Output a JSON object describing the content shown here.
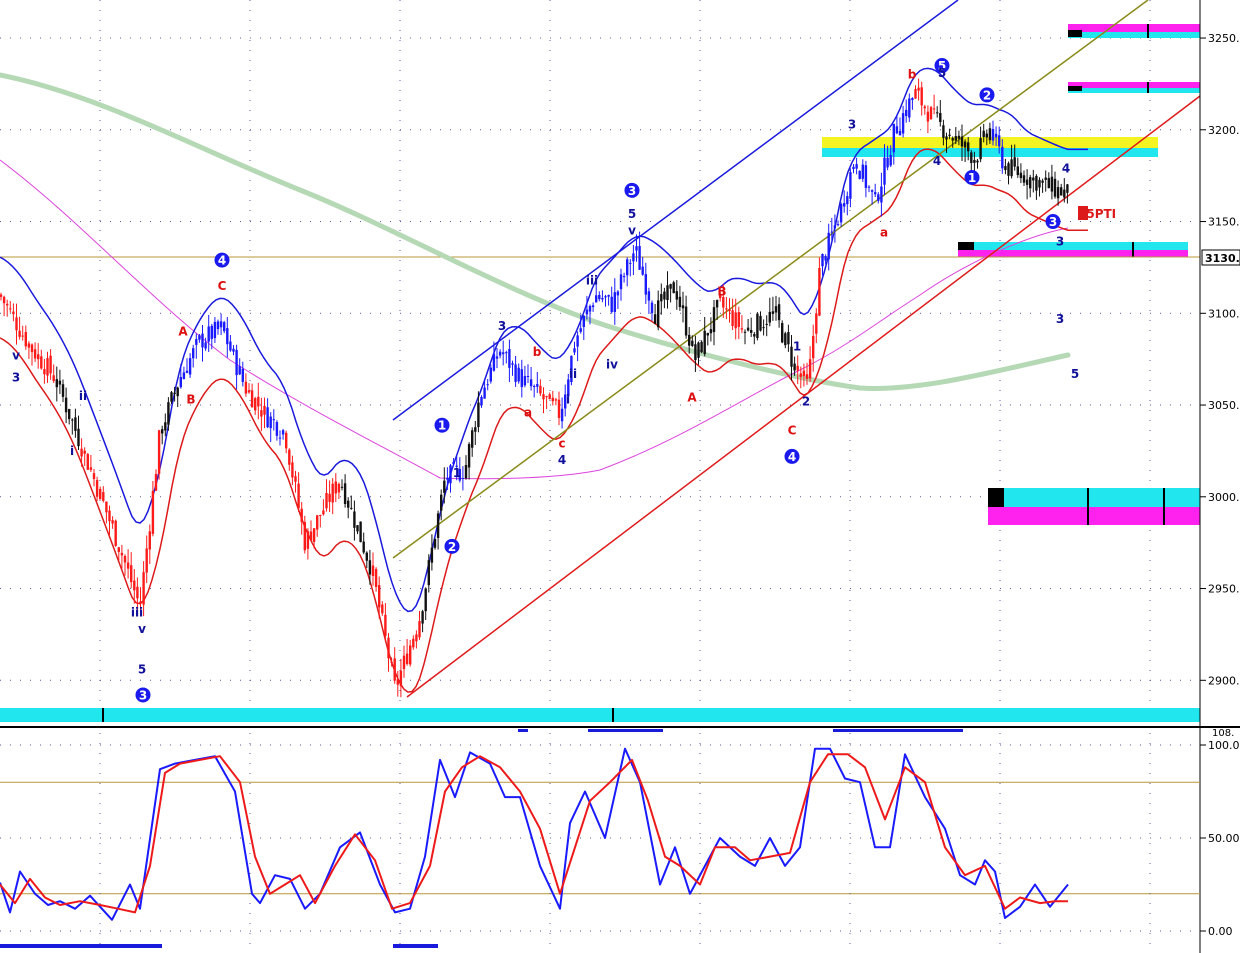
{
  "chart_data": [
    {
      "type": "candlestick",
      "panel": "price",
      "title": "",
      "xlabel": "",
      "ylabel": "",
      "ylim": [
        2880,
        3268
      ],
      "y_ticks": [
        2900,
        2950,
        3000,
        3050,
        3100,
        3150,
        3200,
        3250
      ],
      "y_tick_labels": [
        "2900.",
        "2950.",
        "3000.",
        "3050.",
        "3100.",
        "3150.",
        "3200.",
        "3250."
      ],
      "grid": "dotted",
      "last_value": 3130,
      "last_value_label": "3130.0",
      "colors": {
        "up": "#1a1aff",
        "down": "#ff1a1a",
        "neutral": "#111111",
        "wave_blue": "#10109a",
        "wave_red": "#dd1111"
      },
      "waypoints": [
        {
          "x": 0,
          "close": 3110,
          "color": "red"
        },
        {
          "x": 30,
          "close": 3082,
          "color": "red"
        },
        {
          "x": 55,
          "close": 3065,
          "color": "black"
        },
        {
          "x": 80,
          "close": 3030,
          "color": "red"
        },
        {
          "x": 118,
          "close": 2975,
          "color": "red"
        },
        {
          "x": 140,
          "close": 2940,
          "color": "red"
        },
        {
          "x": 160,
          "close": 3035,
          "color": "black"
        },
        {
          "x": 180,
          "close": 3065,
          "color": "blue"
        },
        {
          "x": 200,
          "close": 3085,
          "color": "blue"
        },
        {
          "x": 222,
          "close": 3092,
          "color": "blue"
        },
        {
          "x": 245,
          "close": 3060,
          "color": "red"
        },
        {
          "x": 265,
          "close": 3045,
          "color": "blue"
        },
        {
          "x": 285,
          "close": 3035,
          "color": "red"
        },
        {
          "x": 305,
          "close": 2975,
          "color": "red"
        },
        {
          "x": 340,
          "close": 3010,
          "color": "black"
        },
        {
          "x": 372,
          "close": 2960,
          "color": "red"
        },
        {
          "x": 395,
          "close": 2895,
          "color": "red"
        },
        {
          "x": 420,
          "close": 2935,
          "color": "black"
        },
        {
          "x": 445,
          "close": 3010,
          "color": "blue"
        },
        {
          "x": 465,
          "close": 3015,
          "color": "black"
        },
        {
          "x": 480,
          "close": 3055,
          "color": "blue"
        },
        {
          "x": 500,
          "close": 3080,
          "color": "blue"
        },
        {
          "x": 520,
          "close": 3065,
          "color": "blue"
        },
        {
          "x": 540,
          "close": 3055,
          "color": "red"
        },
        {
          "x": 560,
          "close": 3045,
          "color": "blue"
        },
        {
          "x": 575,
          "close": 3085,
          "color": "blue"
        },
        {
          "x": 595,
          "close": 3110,
          "color": "blue"
        },
        {
          "x": 612,
          "close": 3105,
          "color": "blue"
        },
        {
          "x": 635,
          "close": 3135,
          "color": "blue"
        },
        {
          "x": 655,
          "close": 3100,
          "color": "black"
        },
        {
          "x": 675,
          "close": 3115,
          "color": "black"
        },
        {
          "x": 695,
          "close": 3075,
          "color": "black"
        },
        {
          "x": 720,
          "close": 3105,
          "color": "red"
        },
        {
          "x": 745,
          "close": 3090,
          "color": "black"
        },
        {
          "x": 775,
          "close": 3100,
          "color": "black"
        },
        {
          "x": 795,
          "close": 3070,
          "color": "red"
        },
        {
          "x": 808,
          "close": 3060,
          "color": "red"
        },
        {
          "x": 820,
          "close": 3125,
          "color": "blue"
        },
        {
          "x": 840,
          "close": 3155,
          "color": "blue"
        },
        {
          "x": 855,
          "close": 3185,
          "color": "blue"
        },
        {
          "x": 875,
          "close": 3160,
          "color": "blue"
        },
        {
          "x": 895,
          "close": 3200,
          "color": "blue"
        },
        {
          "x": 915,
          "close": 3220,
          "color": "red"
        },
        {
          "x": 935,
          "close": 3205,
          "color": "black"
        },
        {
          "x": 955,
          "close": 3195,
          "color": "black"
        },
        {
          "x": 975,
          "close": 3185,
          "color": "black"
        },
        {
          "x": 990,
          "close": 3200,
          "color": "blue"
        },
        {
          "x": 1005,
          "close": 3180,
          "color": "black"
        },
        {
          "x": 1025,
          "close": 3175,
          "color": "black"
        },
        {
          "x": 1045,
          "close": 3170,
          "color": "black"
        },
        {
          "x": 1068,
          "close": 3165,
          "color": "black"
        }
      ],
      "wave_labels": [
        {
          "text": "v",
          "x": 16,
          "y": 3077,
          "color": "wave_blue",
          "circled": false
        },
        {
          "text": "3",
          "x": 16,
          "y": 3065,
          "color": "wave_blue",
          "circled": false
        },
        {
          "text": "ii",
          "x": 83,
          "y": 3055,
          "color": "wave_blue",
          "circled": false
        },
        {
          "text": "i",
          "x": 72,
          "y": 3025,
          "color": "wave_blue",
          "circled": false
        },
        {
          "text": "iii",
          "x": 137,
          "y": 2937,
          "color": "wave_blue",
          "circled": false
        },
        {
          "text": "v",
          "x": 142,
          "y": 2928,
          "color": "wave_blue",
          "circled": false
        },
        {
          "text": "5",
          "x": 142,
          "y": 2906,
          "color": "wave_blue",
          "circled": false
        },
        {
          "text": "3",
          "x": 143,
          "y": 2892,
          "color": "wave_blue",
          "circled": true
        },
        {
          "text": "4",
          "x": 222,
          "y": 3129,
          "color": "wave_blue",
          "circled": true
        },
        {
          "text": "C",
          "x": 222,
          "y": 3115,
          "color": "wave_red",
          "circled": false
        },
        {
          "text": "A",
          "x": 183,
          "y": 3090,
          "color": "wave_red",
          "circled": false
        },
        {
          "text": "B",
          "x": 191,
          "y": 3053,
          "color": "wave_red",
          "circled": false
        },
        {
          "text": "1",
          "x": 442,
          "y": 3039,
          "color": "wave_blue",
          "circled": true
        },
        {
          "text": "1",
          "x": 457,
          "y": 3013,
          "color": "wave_blue",
          "circled": false
        },
        {
          "text": "2",
          "x": 452,
          "y": 2973,
          "color": "wave_blue",
          "circled": true
        },
        {
          "text": "3",
          "x": 502,
          "y": 3093,
          "color": "wave_blue",
          "circled": false
        },
        {
          "text": "b",
          "x": 537,
          "y": 3079,
          "color": "wave_red",
          "circled": false
        },
        {
          "text": "a",
          "x": 528,
          "y": 3046,
          "color": "wave_red",
          "circled": false
        },
        {
          "text": "i",
          "x": 568,
          "y": 3053,
          "color": "wave_blue",
          "circled": false
        },
        {
          "text": "c",
          "x": 562,
          "y": 3029,
          "color": "wave_red",
          "circled": false
        },
        {
          "text": "4",
          "x": 562,
          "y": 3020,
          "color": "wave_blue",
          "circled": false
        },
        {
          "text": "ii",
          "x": 573,
          "y": 3067,
          "color": "wave_blue",
          "circled": false
        },
        {
          "text": "iii",
          "x": 592,
          "y": 3118,
          "color": "wave_blue",
          "circled": false
        },
        {
          "text": "iv",
          "x": 612,
          "y": 3072,
          "color": "wave_blue",
          "circled": false
        },
        {
          "text": "3",
          "x": 632,
          "y": 3167,
          "color": "wave_blue",
          "circled": true
        },
        {
          "text": "5",
          "x": 632,
          "y": 3154,
          "color": "wave_blue",
          "circled": false
        },
        {
          "text": "v",
          "x": 632,
          "y": 3145,
          "color": "wave_blue",
          "circled": false
        },
        {
          "text": "B",
          "x": 722,
          "y": 3112,
          "color": "wave_red",
          "circled": false
        },
        {
          "text": "A",
          "x": 692,
          "y": 3054,
          "color": "wave_red",
          "circled": false
        },
        {
          "text": "1",
          "x": 797,
          "y": 3082,
          "color": "wave_blue",
          "circled": false
        },
        {
          "text": "2",
          "x": 806,
          "y": 3052,
          "color": "wave_blue",
          "circled": false
        },
        {
          "text": "C",
          "x": 792,
          "y": 3036,
          "color": "wave_red",
          "circled": false
        },
        {
          "text": "4",
          "x": 792,
          "y": 3022,
          "color": "wave_blue",
          "circled": true
        },
        {
          "text": "3",
          "x": 852,
          "y": 3203,
          "color": "wave_blue",
          "circled": false
        },
        {
          "text": "a",
          "x": 884,
          "y": 3144,
          "color": "wave_red",
          "circled": false
        },
        {
          "text": "4",
          "x": 937,
          "y": 3183,
          "color": "wave_blue",
          "circled": false
        },
        {
          "text": "b",
          "x": 912,
          "y": 3230,
          "color": "wave_red",
          "circled": false
        },
        {
          "text": "5",
          "x": 942,
          "y": 3235,
          "color": "wave_blue",
          "circled": true
        },
        {
          "text": "5",
          "x": 942,
          "y": 3231,
          "color": "wave_blue",
          "circled": false
        },
        {
          "text": "1",
          "x": 972,
          "y": 3174,
          "color": "wave_blue",
          "circled": true
        },
        {
          "text": "2",
          "x": 987,
          "y": 3219,
          "color": "wave_blue",
          "circled": true
        },
        {
          "text": "4",
          "x": 1066,
          "y": 3179,
          "color": "wave_blue",
          "circled": false
        },
        {
          "text": "3",
          "x": 1053,
          "y": 3150,
          "color": "wave_blue",
          "circled": true
        },
        {
          "text": "3",
          "x": 1060,
          "y": 3139,
          "color": "wave_blue",
          "circled": false
        },
        {
          "text": "3",
          "x": 1060,
          "y": 3097,
          "color": "wave_blue",
          "circled": false
        },
        {
          "text": "5",
          "x": 1075,
          "y": 3067,
          "color": "wave_blue",
          "circled": false
        }
      ],
      "annotation": {
        "text": "55PTI",
        "x": 1085,
        "y": 3152,
        "color": "wave_red"
      }
    },
    {
      "type": "line",
      "panel": "oscillator",
      "title": "",
      "ylim": [
        -5,
        108
      ],
      "y_ticks": [
        0,
        50,
        100
      ],
      "y_tick_labels": [
        "0.00",
        "50.00",
        "100.0"
      ],
      "y_top_partial_label": "108.",
      "reference_lines": [
        20,
        80
      ],
      "series": [
        {
          "color": "#1a1aff",
          "x": [
            0,
            10,
            20,
            35,
            48,
            60,
            75,
            90,
            112,
            130,
            140,
            160,
            175,
            195,
            215,
            235,
            252,
            260,
            275,
            290,
            305,
            320,
            340,
            360,
            380,
            395,
            410,
            425,
            440,
            455,
            470,
            490,
            505,
            520,
            540,
            560,
            570,
            585,
            605,
            625,
            640,
            660,
            675,
            690,
            705,
            720,
            740,
            755,
            770,
            785,
            800,
            815,
            830,
            845,
            860,
            875,
            890,
            905,
            925,
            945,
            960,
            975,
            985,
            995,
            1005,
            1020,
            1035,
            1050,
            1068
          ],
          "values": [
            26,
            10,
            32,
            20,
            14,
            16,
            12,
            19,
            6,
            25,
            12,
            87,
            90,
            92,
            94,
            75,
            20,
            15,
            30,
            28,
            12,
            20,
            45,
            53,
            25,
            10,
            12,
            40,
            92,
            72,
            96,
            90,
            72,
            72,
            35,
            12,
            58,
            75,
            50,
            98,
            80,
            25,
            45,
            20,
            35,
            50,
            40,
            35,
            50,
            35,
            45,
            98,
            98,
            82,
            80,
            45,
            45,
            95,
            72,
            55,
            30,
            25,
            38,
            32,
            7,
            13,
            25,
            13,
            25
          ]
        },
        {
          "color": "#ee1a1a",
          "x": [
            0,
            15,
            30,
            45,
            60,
            80,
            100,
            118,
            135,
            150,
            165,
            180,
            200,
            220,
            240,
            255,
            270,
            285,
            300,
            315,
            335,
            355,
            375,
            392,
            410,
            430,
            445,
            462,
            480,
            500,
            520,
            540,
            560,
            575,
            590,
            610,
            632,
            648,
            665,
            680,
            700,
            715,
            735,
            750,
            770,
            790,
            810,
            828,
            848,
            865,
            885,
            905,
            925,
            945,
            965,
            985,
            1005,
            1020,
            1040,
            1055,
            1068
          ],
          "values": [
            25,
            15,
            28,
            18,
            14,
            16,
            14,
            12,
            10,
            35,
            85,
            90,
            92,
            94,
            80,
            40,
            20,
            25,
            30,
            15,
            35,
            52,
            38,
            12,
            15,
            35,
            75,
            88,
            94,
            88,
            75,
            55,
            20,
            45,
            70,
            80,
            92,
            70,
            40,
            35,
            25,
            45,
            45,
            38,
            40,
            42,
            80,
            95,
            95,
            88,
            60,
            88,
            80,
            45,
            30,
            35,
            12,
            18,
            15,
            16,
            16
          ]
        }
      ]
    }
  ],
  "axis": {
    "y_labels": [
      "3250.",
      "3200.",
      "3150.",
      "3100.",
      "3050.",
      "3000.",
      "2950.",
      "2900."
    ],
    "osc_labels": [
      "100.0",
      "50.00",
      "0.00"
    ],
    "last_value_label": "3130.0",
    "top_partial_label": "108."
  },
  "annotation_text": "55PTI"
}
